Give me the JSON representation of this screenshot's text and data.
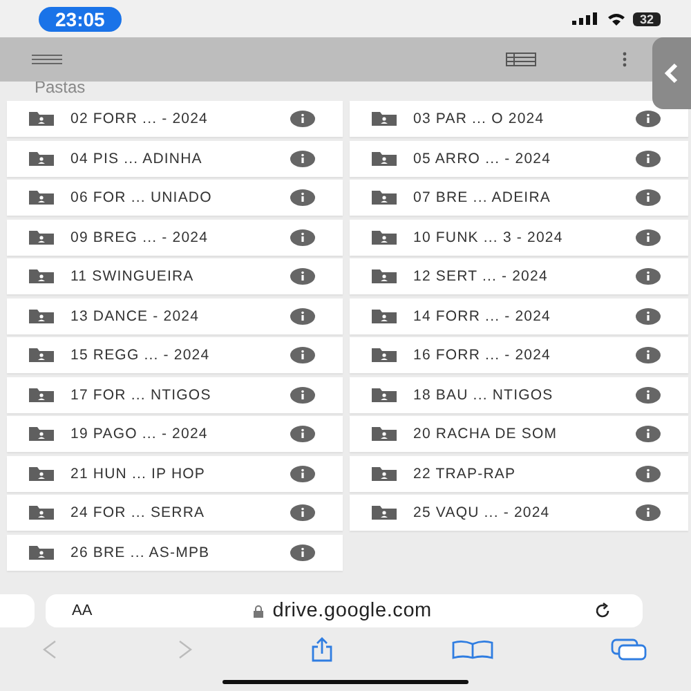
{
  "status_bar": {
    "time": "23:05",
    "battery": "32"
  },
  "section_title": "Pastas",
  "folders": [
    {
      "name": "02 FORR ... - 2024"
    },
    {
      "name": "03 PAR ... O 2024"
    },
    {
      "name": "04 PIS ... ADINHA"
    },
    {
      "name": "05 ARRO ... - 2024"
    },
    {
      "name": "06 FOR ... UNIADO"
    },
    {
      "name": "07 BRE ... ADEIRA"
    },
    {
      "name": "09 BREG ... - 2024"
    },
    {
      "name": "10 FUNK ... 3 - 2024"
    },
    {
      "name": "11 SWINGUEIRA"
    },
    {
      "name": "12 SERT ... - 2024"
    },
    {
      "name": "13 DANCE - 2024"
    },
    {
      "name": "14 FORR ... - 2024"
    },
    {
      "name": "15 REGG ... - 2024"
    },
    {
      "name": "16 FORR ... - 2024"
    },
    {
      "name": "17 FOR ... NTIGOS"
    },
    {
      "name": "18 BAU ... NTIGOS"
    },
    {
      "name": "19 PAGO ... - 2024"
    },
    {
      "name": "20 RACHA DE SOM"
    },
    {
      "name": "21 HUN ... IP HOP"
    },
    {
      "name": "22 TRAP-RAP"
    },
    {
      "name": "24 FOR ... SERRA"
    },
    {
      "name": "25 VAQU ... - 2024"
    },
    {
      "name": "26 BRE ... AS-MPB"
    }
  ],
  "browser": {
    "text_size_label": "AA",
    "url": "drive.google.com"
  }
}
